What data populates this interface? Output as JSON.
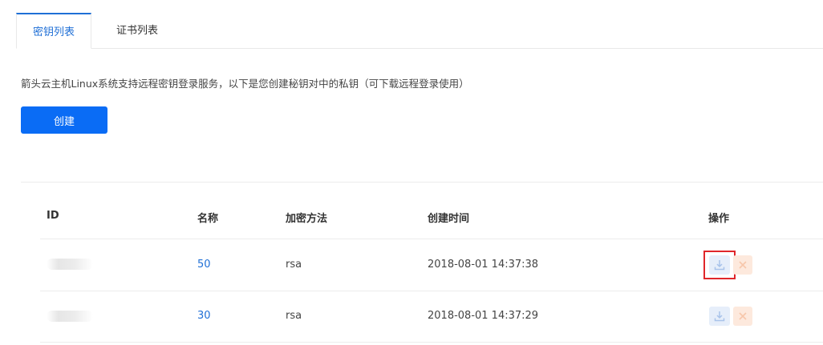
{
  "tabs": [
    {
      "label": "密钥列表",
      "active": true
    },
    {
      "label": "证书列表",
      "active": false
    }
  ],
  "description": "箭头云主机Linux系统支持远程密钥登录服务，以下是您创建秘钥对中的私钥（可下载远程登录使用）",
  "create_button": "创建",
  "table": {
    "headers": {
      "id": "ID",
      "name": "名称",
      "encryption": "加密方法",
      "created": "创建时间",
      "actions": "操作"
    },
    "rows": [
      {
        "name": "50",
        "encryption": "rsa",
        "created": "2018-08-01 14:37:38"
      },
      {
        "name": "30",
        "encryption": "rsa",
        "created": "2018-08-01 14:37:29"
      }
    ]
  },
  "icons": {
    "download": "download-icon",
    "delete": "close-icon"
  },
  "colors": {
    "accent": "#1f6fd6",
    "primary_button": "#0a6cf5",
    "highlight": "#e0262a"
  }
}
